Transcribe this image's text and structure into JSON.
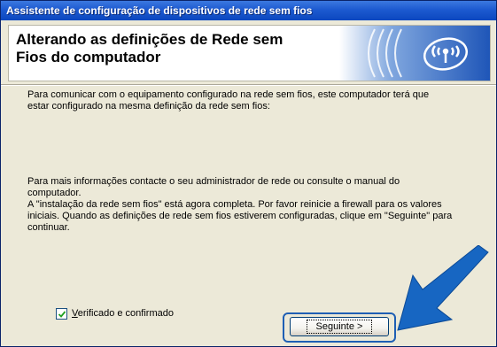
{
  "window": {
    "title": "Assistente de configuração de dispositivos de rede sem fios"
  },
  "header": {
    "title": "Alterando as definições de Rede sem Fios do computador"
  },
  "body": {
    "paragraph1": "Para comunicar com o equipamento configurado na rede sem fios, este computador terá que estar configurado na mesma definição da rede sem fios:",
    "paragraph2": "Para mais informações contacte o seu administrador de rede ou consulte o manual do computador.\nA \"instalação da rede sem fios\" está agora completa. Por favor reinicie a firewall para os valores iniciais. Quando as definições de rede sem fios estiverem configuradas, clique em \"Seguinte\" para continuar."
  },
  "confirm_checkbox": {
    "label": "Verificado e confirmado",
    "checked": true
  },
  "next_button": {
    "label": "Seguinte >"
  },
  "colors": {
    "titlebar": "#0b47bf",
    "highlight": "#1f5fb4",
    "arrow": "#1766c2"
  },
  "icons": {
    "header_art": "wireless-signal-icon",
    "pointer": "blue-arrow-icon"
  }
}
